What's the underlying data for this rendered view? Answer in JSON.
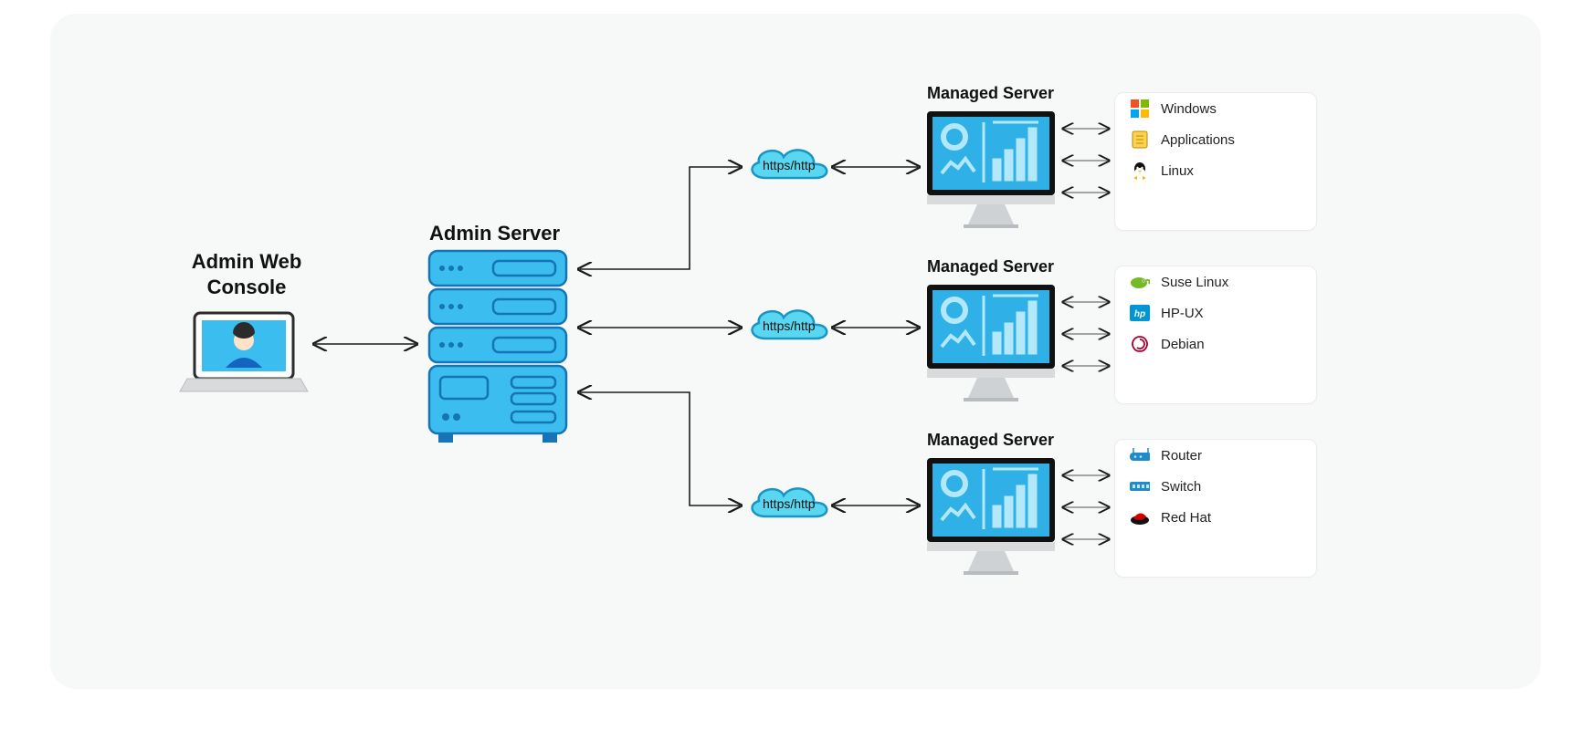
{
  "labels": {
    "admin_web_console": "Admin Web\nConsole",
    "admin_server": "Admin Server",
    "managed_server": "Managed Server",
    "protocol": "https/http"
  },
  "groups": [
    {
      "items": [
        {
          "icon": "windows",
          "label": "Windows"
        },
        {
          "icon": "applications",
          "label": "Applications"
        },
        {
          "icon": "linux",
          "label": "Linux"
        }
      ]
    },
    {
      "items": [
        {
          "icon": "suse",
          "label": "Suse Linux"
        },
        {
          "icon": "hpux",
          "label": "HP-UX"
        },
        {
          "icon": "debian",
          "label": "Debian"
        }
      ]
    },
    {
      "items": [
        {
          "icon": "router",
          "label": "Router"
        },
        {
          "icon": "switch",
          "label": "Switch"
        },
        {
          "icon": "redhat",
          "label": "Red Hat"
        }
      ]
    }
  ],
  "colors": {
    "accent_fill": "#3bbeef",
    "accent_stroke": "#1574b6",
    "cloud_fill": "#5ad7f0",
    "cloud_stroke": "#1a94c5",
    "monitor_screen": "#2fb0e6",
    "monitor_graphics": "#b3e8fb",
    "arrow": "#1a1a1a"
  }
}
